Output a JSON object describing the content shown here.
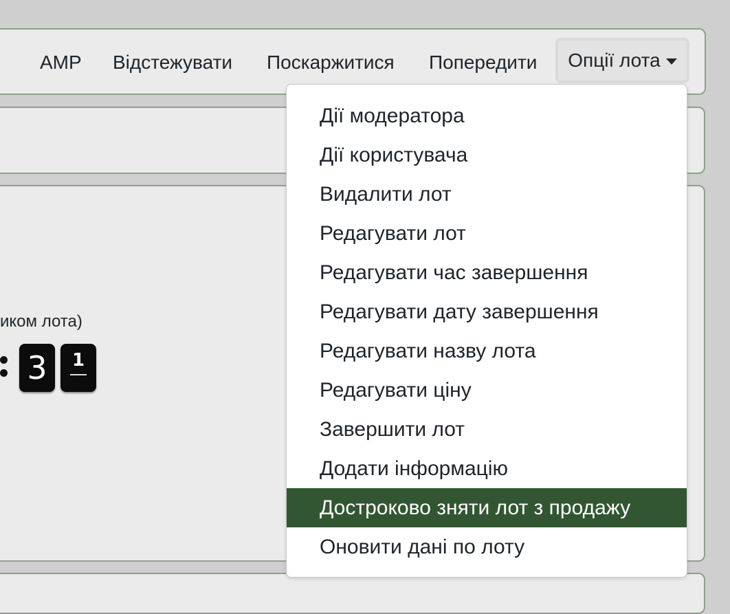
{
  "nav": {
    "amp": "AMP",
    "follow": "Відстежувати",
    "report": "Поскаржитися",
    "warn": "Попередити",
    "lot_options": "Опції лота"
  },
  "main": {
    "organizer_note": "иком лота)",
    "countdown": {
      "digit_1": "3",
      "digit_2": "1"
    }
  },
  "dropdown": {
    "items": [
      {
        "label": "Дії модератора"
      },
      {
        "label": "Дії користувача"
      },
      {
        "label": "Видалити лот"
      },
      {
        "label": "Редагувати лот"
      },
      {
        "label": "Редагувати час завершення"
      },
      {
        "label": "Редагувати дату завершення"
      },
      {
        "label": "Редагувати назву лота"
      },
      {
        "label": "Редагувати ціну"
      },
      {
        "label": "Завершити лот"
      },
      {
        "label": "Додати інформацію"
      },
      {
        "label": "Достроково зняти лот з продажу"
      },
      {
        "label": "Оновити дані по лоту"
      }
    ],
    "active_index": 10
  },
  "colors": {
    "accent_green": "#325632",
    "panel_border": "#8fa08d",
    "panel_bg": "#ebebeb"
  },
  "icons": {
    "dropdown_toggle": "caret-down-icon"
  }
}
